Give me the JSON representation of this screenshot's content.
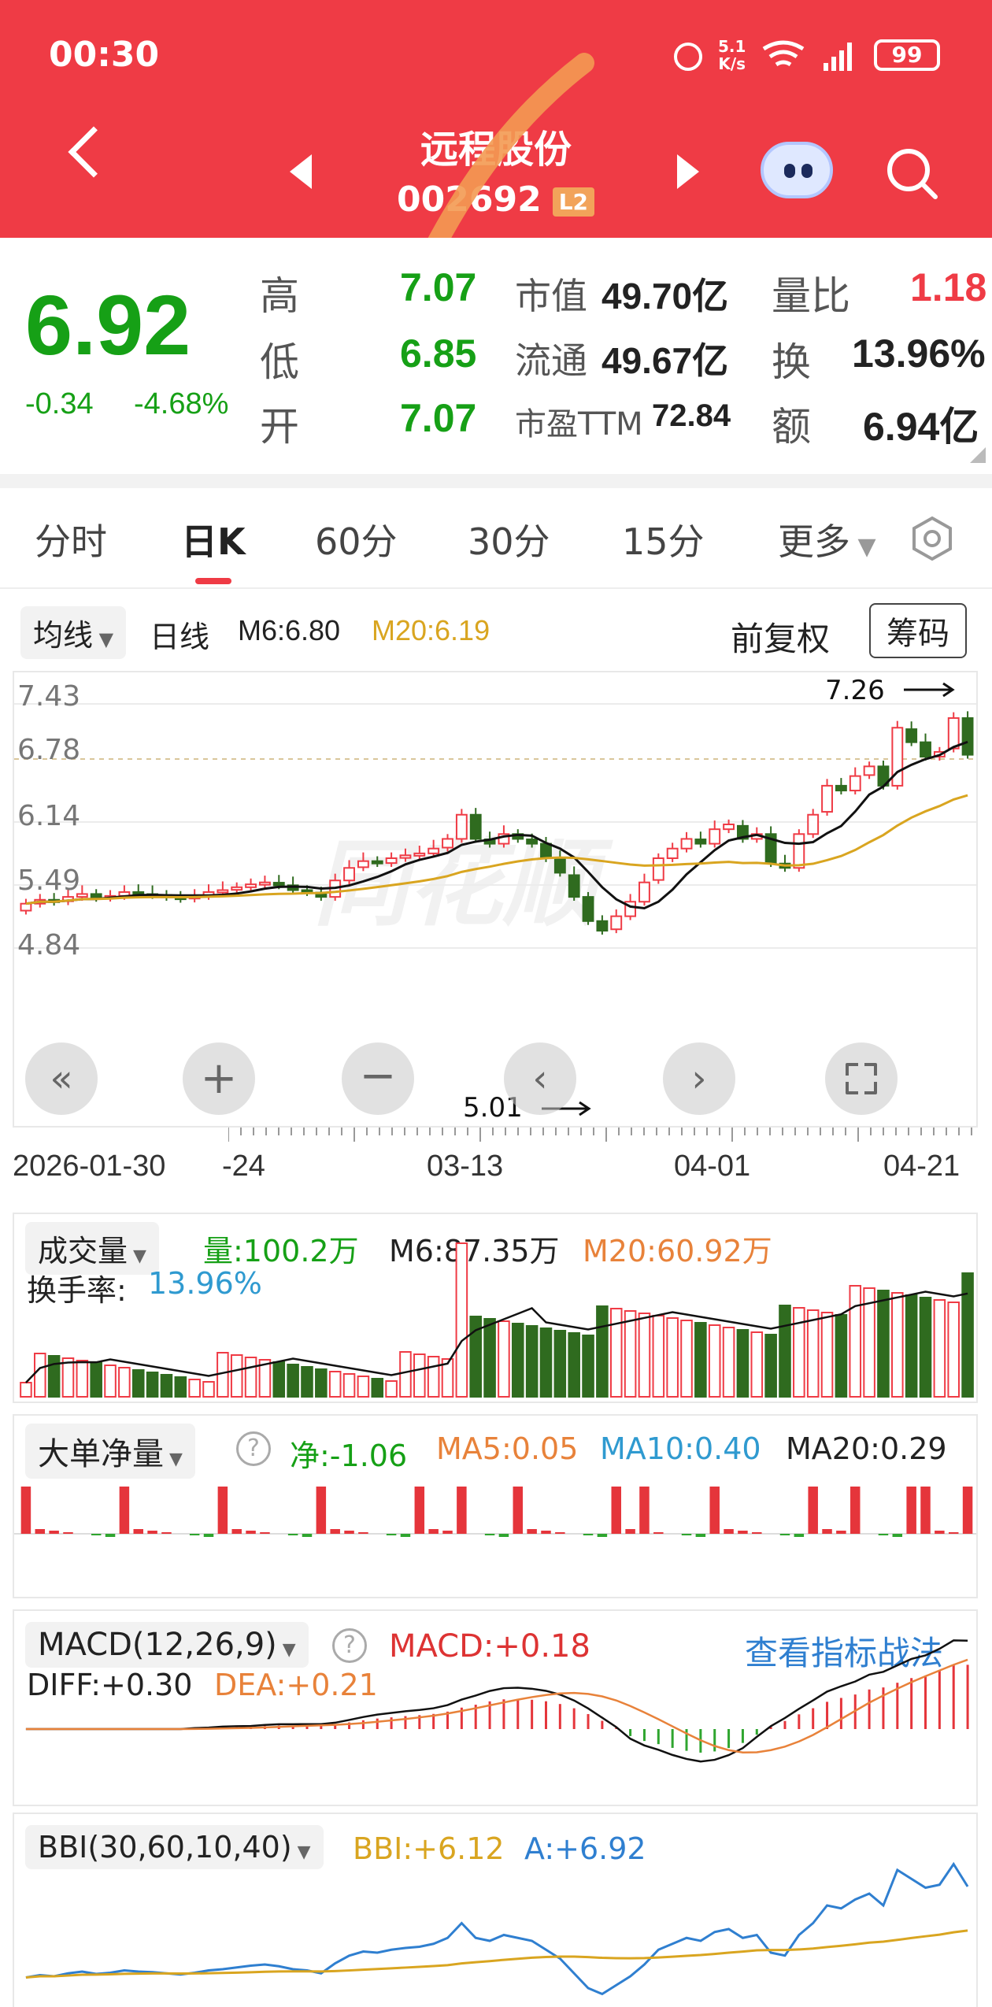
{
  "status_bar": {
    "time": "00:30",
    "net_speed_value": "5.1",
    "net_speed_unit": "K/s",
    "battery": "99"
  },
  "header": {
    "stock_name": "远程股份",
    "stock_code": "002692",
    "l2_badge": "L2"
  },
  "quote": {
    "price": "6.92",
    "change": "-0.34",
    "change_pct": "-4.68%",
    "high_label": "高",
    "high": "7.07",
    "low_label": "低",
    "low": "6.85",
    "open_label": "开",
    "open": "7.07",
    "mktcap_label": "市值",
    "mktcap": "49.70亿",
    "float_label": "流通",
    "float": "49.67亿",
    "pe_label": "市盈TTM",
    "pe": "72.84",
    "vol_ratio_label": "量比",
    "vol_ratio": "1.18",
    "turnover_label": "换",
    "turnover": "13.96%",
    "amount_label": "额",
    "amount": "6.94亿"
  },
  "tabs": [
    "分时",
    "日K",
    "60分",
    "30分",
    "15分",
    "更多"
  ],
  "kline": {
    "ma_selector": "均线",
    "period": "日线",
    "m6": "M6:6.80",
    "m20": "M20:6.19",
    "adjust": "前复权",
    "chips_button": "筹码",
    "y_ticks": [
      "7.43",
      "6.78",
      "6.14",
      "5.49",
      "4.84"
    ],
    "high_mark": "7.26",
    "low_mark": "5.01",
    "dates": [
      "2026-01-30",
      "-24",
      "03-13",
      "04-01",
      "04-21"
    ],
    "watermark": "同花顺"
  },
  "volume": {
    "selector": "成交量",
    "vol": "量:100.2万",
    "m6": "M6:87.35万",
    "m20": "M20:60.92万",
    "turnover": "换手率:",
    "turnover_val": "13.96%"
  },
  "bigorder": {
    "selector": "大单净量",
    "net": "净:-1.06",
    "ma5": "MA5:0.05",
    "ma10": "MA10:0.40",
    "ma20": "MA20:0.29"
  },
  "macd": {
    "selector": "MACD(12,26,9)",
    "macd": "MACD:+0.18",
    "diff": "DIFF:+0.30",
    "dea": "DEA:+0.21",
    "link": "查看指标战法"
  },
  "bbi": {
    "selector": "BBI(30,60,10,40)",
    "bbi": "BBI:+6.12",
    "a": "A:+6.92"
  },
  "colors": {
    "red": "#ef3b45",
    "green": "#16a016",
    "dark_green": "#2f6b1f",
    "orange": "#e8823a",
    "gold": "#d9a520",
    "blue": "#2f7fd0"
  }
}
